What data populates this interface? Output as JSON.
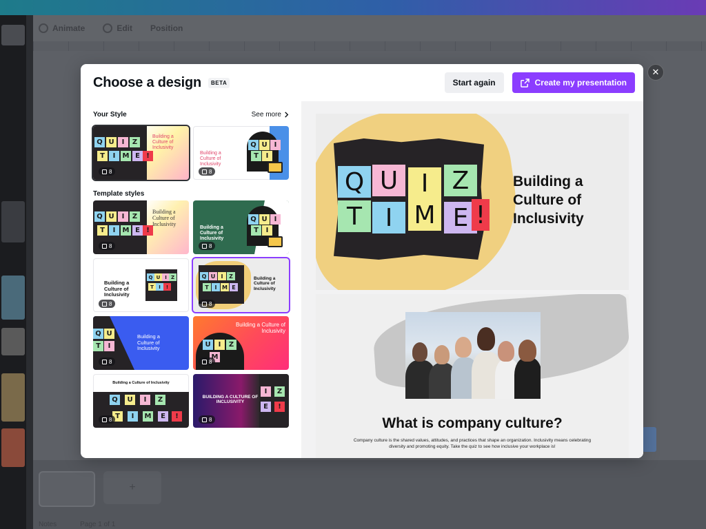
{
  "background": {
    "toolbar": {
      "items": [
        "Animate",
        "Edit",
        "Position"
      ]
    },
    "footer": {
      "notes": "Notes",
      "page": "Page 1 of 1"
    }
  },
  "modal": {
    "title": "Choose a design",
    "badge": "BETA",
    "start_again": "Start again",
    "create": "Create my presentation",
    "close_icon": "close-icon",
    "your_style": {
      "heading": "Your Style",
      "see_more": "See more",
      "items": [
        {
          "title": "Building a Culture of Inclusivity",
          "pages": "8"
        },
        {
          "title": "Building a Culture of Inclusivity",
          "pages": "8"
        }
      ]
    },
    "template_styles": {
      "heading": "Template styles",
      "items": [
        {
          "title": "Building a Culture of Inclusivity",
          "pages": "8"
        },
        {
          "title": "Building a Culture of Inclusivity",
          "pages": "8"
        },
        {
          "title": "Building a Culture of Inclusivity",
          "pages": "8"
        },
        {
          "title": "Building a Culture of Inclusivity",
          "pages": "8"
        },
        {
          "title": "Building a Culture of Inclusivity",
          "pages": "8"
        },
        {
          "title": "Building a Culture of Inclusivity",
          "pages": "8"
        },
        {
          "title": "Building a Culture of Inclusivity",
          "pages": "8"
        },
        {
          "title": "BUILDING A CULTURE OF INCLUSIVITY",
          "pages": "8"
        }
      ]
    },
    "preview": {
      "quiz_letters_row1": [
        "Q",
        "U",
        "I",
        "Z"
      ],
      "quiz_letters_row2": [
        "T",
        "I",
        "M",
        "E",
        "!"
      ],
      "slide1_title": "Building a Culture of Inclusivity",
      "slide2_title": "What is company culture?",
      "slide2_body": "Company culture is the shared values, attitudes, and practices that shape an organization. Inclusivity means celebrating diversity and promoting equity. Take the quiz to see how inclusive your workplace is!"
    }
  },
  "colors": {
    "accent": "#8b3dff",
    "note_blue": "#8fd3f0",
    "note_yellow": "#f6ec8c",
    "note_green": "#a6e6b0",
    "note_pink": "#f6b7d4",
    "note_purple": "#cdb7f0",
    "note_red": "#ef3b4a"
  }
}
